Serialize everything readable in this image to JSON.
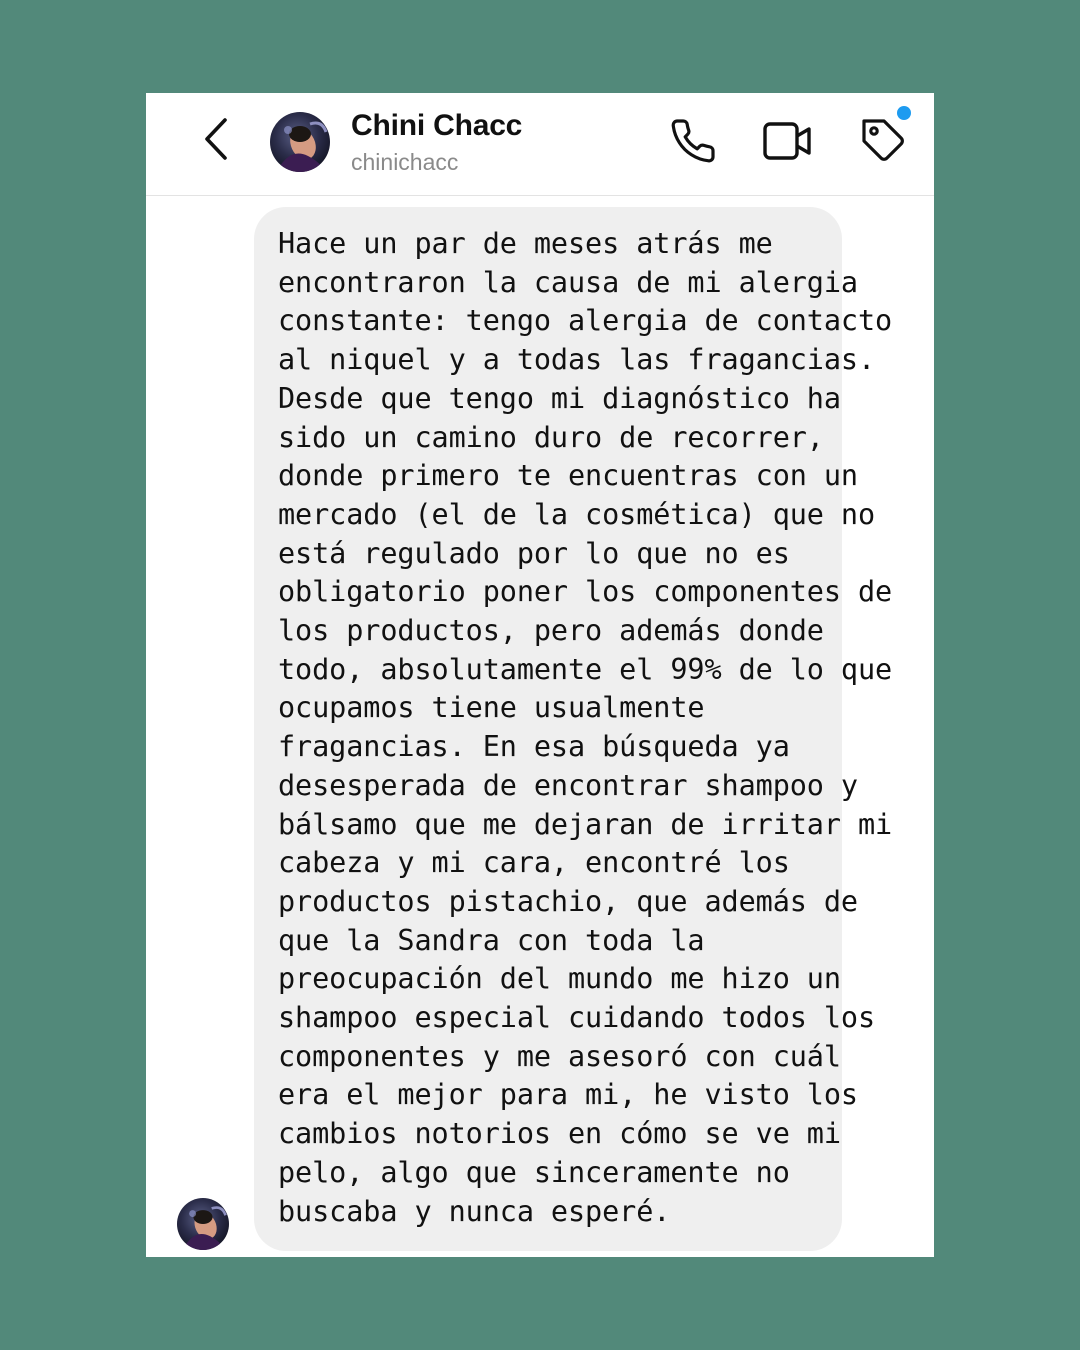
{
  "contact": {
    "name": "Chini Chacc",
    "handle": "chinichacc"
  },
  "header": {
    "icons": [
      "back-chevron-icon",
      "phone-icon",
      "video-camera-icon",
      "tag-icon"
    ],
    "notification_dot": true
  },
  "colors": {
    "page_background": "#52897a",
    "screen_background": "#ffffff",
    "bubble_background": "#efefef",
    "text": "#111111",
    "secondary_text": "#8a8a8a",
    "notification_dot": "#1d9bf0"
  },
  "message": {
    "sender": "incoming",
    "lines": [
      "Hace un par de meses atrás me",
      "encontraron la causa de mi alergia",
      "constante: tengo alergia de contacto",
      "al niquel y a todas las fragancias.",
      "Desde que tengo mi diagnóstico ha",
      "sido un camino duro de recorrer,",
      "donde primero te encuentras con un",
      "mercado (el de la cosmética) que no",
      "está regulado por lo que no es",
      "obligatorio poner los componentes de",
      "los productos, pero además donde",
      "todo, absolutamente el 99% de lo que",
      "ocupamos tiene usualmente",
      "fragancias. En esa búsqueda ya",
      "desesperada de encontrar shampoo y",
      "bálsamo que me dejaran de irritar mi",
      "cabeza y mi cara, encontré los",
      "productos pistachio, que además de",
      "que la Sandra con toda la",
      "preocupación del mundo me hizo un",
      "shampoo especial cuidando todos los",
      "componentes y me asesoró con cuál",
      "era el mejor para mi, he visto los",
      "cambios notorios en cómo se ve mi",
      "pelo, algo que sinceramente no",
      "buscaba y nunca esperé."
    ]
  }
}
